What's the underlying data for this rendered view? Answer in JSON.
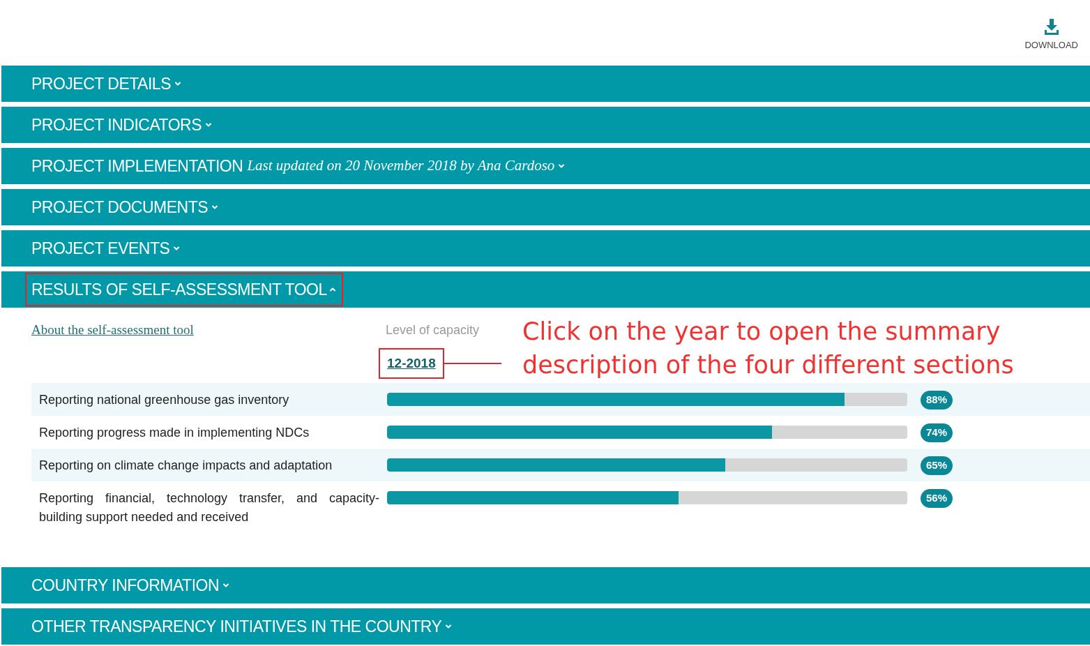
{
  "download": {
    "label": "DOWNLOAD"
  },
  "sections": [
    {
      "title": "PROJECT DETAILS",
      "expanded": false
    },
    {
      "title": "PROJECT INDICATORS",
      "expanded": false
    },
    {
      "title": "PROJECT IMPLEMENTATION",
      "subtitle": "Last updated on 20 November 2018 by Ana Cardoso",
      "expanded": false
    },
    {
      "title": "PROJECT DOCUMENTS",
      "expanded": false
    },
    {
      "title": "PROJECT EVENTS",
      "expanded": false
    },
    {
      "title": "RESULTS OF SELF-ASSESSMENT TOOL",
      "expanded": true,
      "highlighted": true,
      "content": {
        "about_link": "About the self-assessment tool",
        "level_heading": "Level of capacity",
        "year": "12-2018",
        "year_highlighted": true,
        "rows": [
          {
            "label": "Reporting national greenhouse gas inventory",
            "level": 0.88,
            "reading": "88%"
          },
          {
            "label": "Reporting progress made in implementing NDCs",
            "level": 0.74,
            "reading": "74%"
          },
          {
            "label": "Reporting on climate change impacts and adaptation",
            "level": 0.65,
            "reading": "65%"
          },
          {
            "label": "Reporting financial, technology transfer, and capacity-building support needed and received",
            "level": 0.56,
            "reading": "56%"
          }
        ]
      }
    },
    {
      "title": "COUNTRY INFORMATION",
      "expanded": false
    },
    {
      "title": "OTHER TRANSPARENCY INITIATIVES IN THE COUNTRY",
      "expanded": false
    }
  ],
  "annotation": {
    "text": "Click on the year to open the summary description of the four different sections"
  }
}
